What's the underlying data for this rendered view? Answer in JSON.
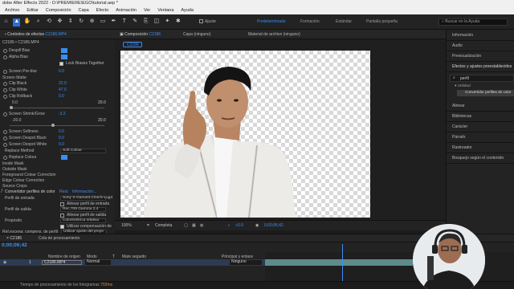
{
  "app_title": "dobe After Effects 2022 - D:\\PREMIERE\\EGO\\tutorial.aep *",
  "menu": [
    "Archivo",
    "Editar",
    "Composición",
    "Capa",
    "Efecto",
    "Animación",
    "Ver",
    "Ventana",
    "Ayuda"
  ],
  "toolbar": {
    "snap_label": "Ajuste",
    "workspaces": [
      "Predeterminado",
      "Formación",
      "Estándar",
      "Pantalla pequeña"
    ],
    "search_placeholder": "Buscar en la Ayuda"
  },
  "effects_panel": {
    "tab_label": "Controles de efectos",
    "clip": "C2186.MP4",
    "breadcrumb": "C2186 • C2186.MP4",
    "rows": [
      {
        "label": "Despill Bias",
        "value": ""
      },
      {
        "label": "Alpha Bias",
        "value": ""
      },
      {
        "label": "Lock Biases Together",
        "value": ""
      },
      {
        "label": "Screen Pre-blur",
        "value": "0.0"
      },
      {
        "label": "Screen Matte",
        "value": ""
      },
      {
        "label": "Clip Black",
        "value": "22.0"
      },
      {
        "label": "Clip White",
        "value": "47.0"
      },
      {
        "label": "Clip Rollback",
        "value": "0.0"
      },
      {
        "label": "0.0",
        "value": "20.0"
      },
      {
        "label": "Screen Shrink/Grow",
        "value": "-3.2"
      },
      {
        "label": "-20.0",
        "value": "20.0"
      },
      {
        "label": "Screen Softness",
        "value": "0.0"
      },
      {
        "label": "Screen Despot Black",
        "value": "0.0"
      },
      {
        "label": "Screen Despot White",
        "value": "0.0"
      },
      {
        "label": "Replace Method",
        "value": "Soft Colour"
      },
      {
        "label": "Replace Colour",
        "value": ""
      },
      {
        "label": "Inside Mask",
        "value": ""
      },
      {
        "label": "Outside Mask",
        "value": ""
      },
      {
        "label": "Foreground Colour Correction",
        "value": ""
      },
      {
        "label": "Edge Colour Correction",
        "value": ""
      },
      {
        "label": "Source Crops",
        "value": ""
      }
    ],
    "converter": {
      "title": "Convertidor perfiles de color",
      "reset": "Rest.",
      "info": "Información...",
      "input_label": "Perfil de entrada",
      "input_value": "Sony S-Gamut3.Cine/S-Log3",
      "input_check": "Alinear perfil de entrada",
      "output_label": "Perfil de salida",
      "output_value": "Rec.709 Gamma 2.4",
      "output_check": "Alinear perfil de salida",
      "intent_label": "Propósito",
      "intent_value": "Colorimétrica relativa",
      "linear_check": "Utilizar compensación de",
      "bottom_left": "Ref.escena: compens. de perfil",
      "bottom_right": "Utilizar ajuste del proye"
    }
  },
  "composition": {
    "tab_label": "Composición",
    "comp_name": "C2186",
    "layer_label": "Capa (ninguno)",
    "footage_label": "Material de archivo (ninguno)",
    "zoom": "100%",
    "resolution": "Completa",
    "exposure": "+0.0",
    "timecode": "0;00;06;42"
  },
  "right_panels": {
    "items_top": [
      "Información",
      "Audio",
      "Previsualización",
      "Efectos y ajustes preestablecidos"
    ],
    "search_value": "perfil",
    "folder": "Utilidad",
    "effect_item": "Convertidor perfiles de color",
    "items_bottom": [
      "Alinear",
      "Bibliotecas",
      "Carácter",
      "Párrafo",
      "Rastreador",
      "Bosquejo según el contenido"
    ]
  },
  "timeline": {
    "tab_comp": "C2186",
    "tab_queue": "Cola de procesamiento",
    "timecode": "0;00;06;42",
    "columns": [
      "Nombre de origen",
      "Modo",
      "T",
      "Mate seguido",
      "Principal y enlace"
    ],
    "layer_index": "1",
    "layer_name": "C2186.MP4",
    "layer_mode": "Normal",
    "layer_parent": "Ninguno"
  },
  "status": {
    "label": "Tiempo de procesamiento de los fotogramas",
    "ms": "792ms"
  }
}
